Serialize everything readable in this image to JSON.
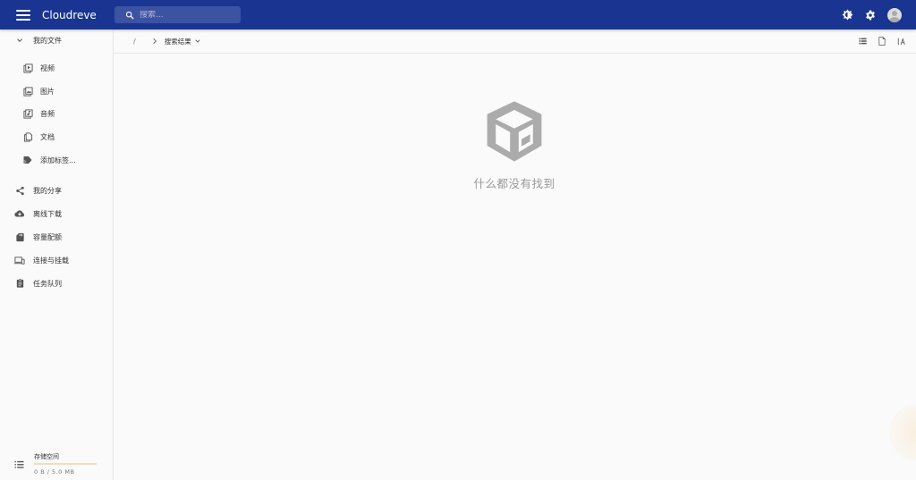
{
  "app": {
    "title": "Cloudreve"
  },
  "search": {
    "placeholder": "搜索..."
  },
  "sidebar": {
    "my_files": "我的文件",
    "sub_items": [
      {
        "label": "视频",
        "icon": "video-file-icon"
      },
      {
        "label": "图片",
        "icon": "image-file-icon"
      },
      {
        "label": "音频",
        "icon": "audio-file-icon"
      },
      {
        "label": "文档",
        "icon": "document-file-icon"
      },
      {
        "label": "添加标签...",
        "icon": "tag-add-icon"
      }
    ],
    "items": [
      {
        "label": "我的分享",
        "icon": "share-icon"
      },
      {
        "label": "离线下载",
        "icon": "cloud-download-icon"
      },
      {
        "label": "容量配额",
        "icon": "sd-card-icon"
      },
      {
        "label": "连接与挂载",
        "icon": "devices-icon"
      },
      {
        "label": "任务队列",
        "icon": "clipboard-icon"
      }
    ],
    "storage": {
      "label": "存储空间",
      "usage": "0 B / 5.0 MB",
      "fraction": 0
    }
  },
  "breadcrumb": {
    "root": "/",
    "current": "搜索结果"
  },
  "empty_state": {
    "message": "什么都没有找到"
  },
  "colors": {
    "appbar": "#1a3591",
    "storage_bar": "#f7ddb4"
  }
}
